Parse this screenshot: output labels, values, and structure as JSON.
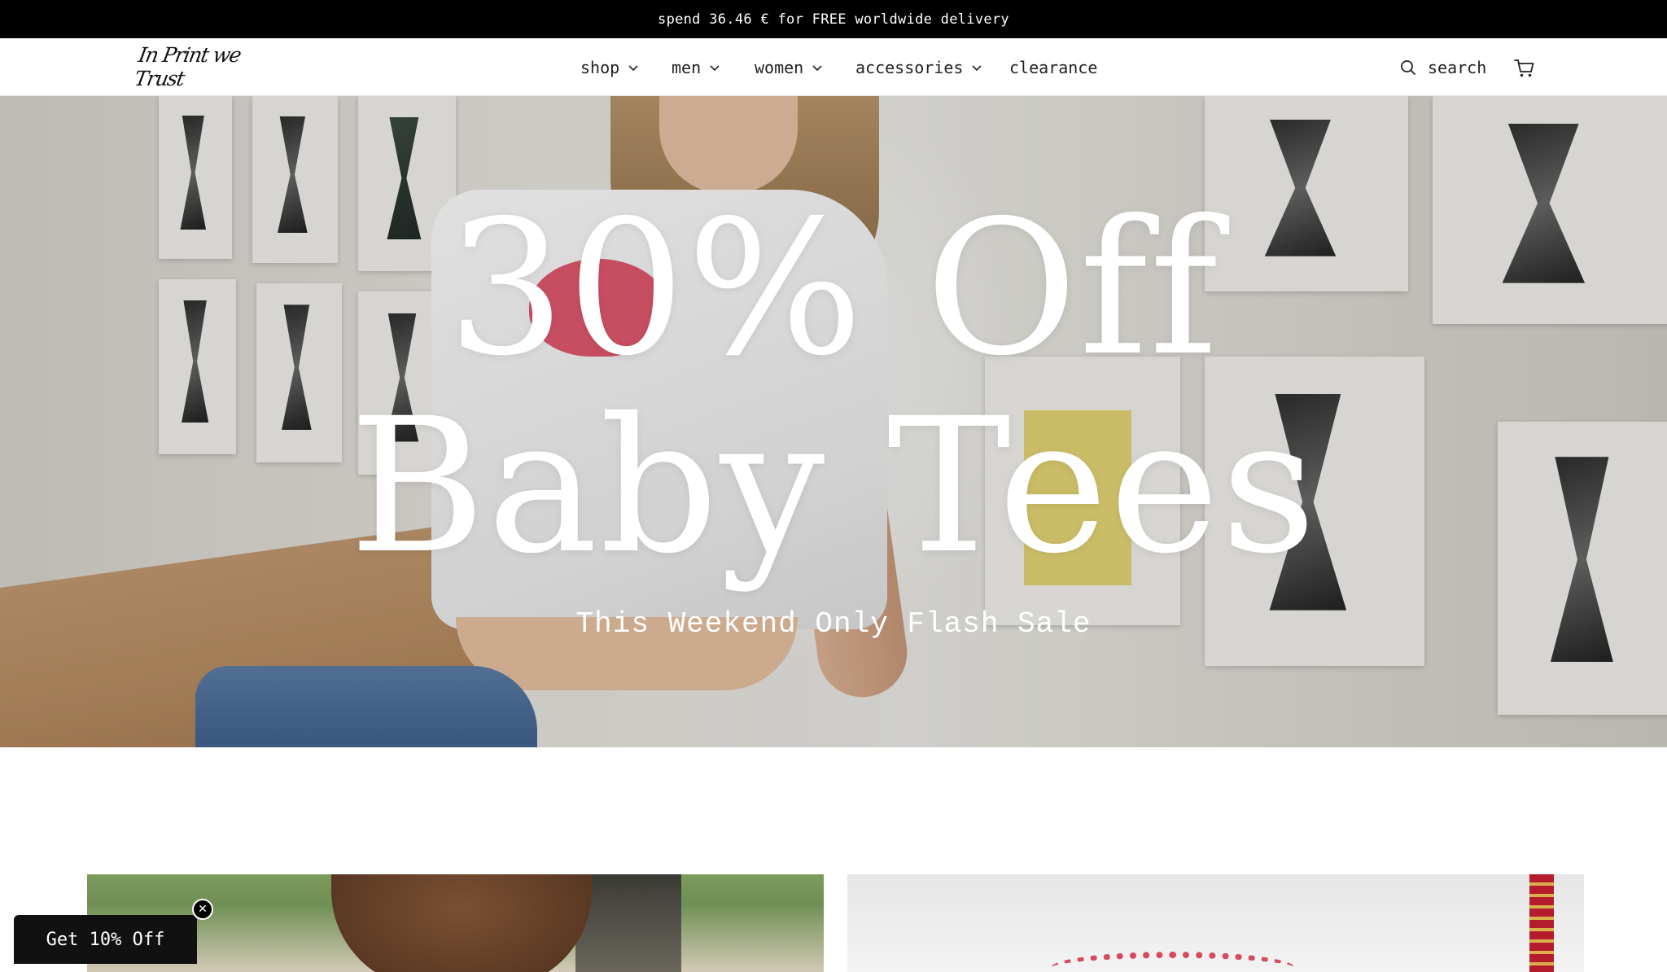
{
  "announcement": {
    "text": "spend 36.46 € for FREE worldwide delivery"
  },
  "header": {
    "logo_text": "In Print we Trust",
    "nav": [
      {
        "label": "shop",
        "has_dropdown": true
      },
      {
        "label": "men",
        "has_dropdown": true
      },
      {
        "label": "women",
        "has_dropdown": true
      },
      {
        "label": "accessories",
        "has_dropdown": true
      },
      {
        "label": "clearance",
        "has_dropdown": false
      }
    ],
    "search_label": "search",
    "icons": {
      "search": "search-icon",
      "cart": "cart-icon",
      "dropdown": "chevron-down-icon"
    }
  },
  "hero": {
    "title_line1": "30% Off",
    "title_line2": "Baby Tees",
    "subtitle": "This Weekend Only Flash Sale"
  },
  "promo": {
    "label": "Get 10% Off",
    "close_icon": "close-icon"
  },
  "colors": {
    "announcement_bg": "#000000",
    "text": "#111111",
    "hero_text": "#ffffff",
    "promo_bg": "#111111"
  }
}
